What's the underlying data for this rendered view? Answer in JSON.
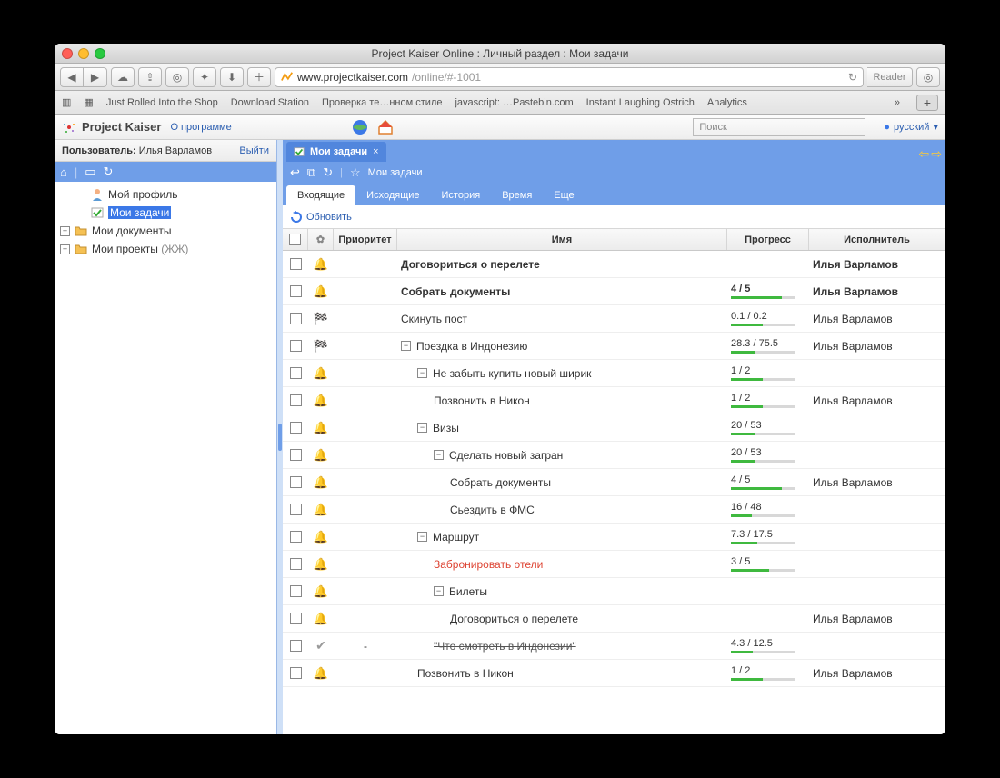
{
  "browser": {
    "title": "Project Kaiser Online : Личный раздел : Мои задачи",
    "url_host": "www.projectkaiser.com",
    "url_path": "/online/#-1001",
    "reader": "Reader",
    "bookmarks": [
      "Just Rolled Into the Shop",
      "Download Station",
      "Проверка те…нном стиле",
      "javascript: …Pastebin.com",
      "Instant Laughing Ostrich",
      "Analytics"
    ]
  },
  "app": {
    "name": "Project Kaiser",
    "about": "О программе",
    "search_placeholder": "Поиск",
    "lang": "русский"
  },
  "sidebar": {
    "user_label": "Пользователь:",
    "user_name": "Илья Варламов",
    "logout": "Выйти",
    "items": [
      {
        "label": "Мой профиль"
      },
      {
        "label": "Мои задачи"
      },
      {
        "label": "Мои документы"
      },
      {
        "label": "Мои проекты",
        "suffix": "(ЖЖ)"
      }
    ]
  },
  "main": {
    "doctab": "Мои задачи",
    "crumb": "Мои задачи",
    "tabs": [
      "Входящие",
      "Исходящие",
      "История",
      "Время",
      "Еще"
    ],
    "refresh": "Обновить",
    "columns": {
      "priority": "Приоритет",
      "name": "Имя",
      "progress": "Прогресс",
      "assignee": "Исполнитель"
    }
  },
  "rows": [
    {
      "icon": "bell",
      "indent": 0,
      "name": "Договориться о перелете",
      "bold": true,
      "assignee": "Илья Варламов"
    },
    {
      "icon": "bell",
      "indent": 0,
      "name": "Собрать документы",
      "bold": true,
      "progress": "4 / 5",
      "pct": 80,
      "assignee": "Илья Варламов"
    },
    {
      "icon": "flag",
      "indent": 0,
      "name": "Скинуть пост",
      "progress": "0.1 / 0.2",
      "pct": 50,
      "assignee": "Илья Варламов"
    },
    {
      "icon": "flag",
      "indent": 0,
      "toggle": true,
      "name": "Поездка в Индонезию",
      "progress": "28.3 / 75.5",
      "pct": 37,
      "assignee": "Илья Варламов"
    },
    {
      "icon": "bell",
      "indent": 1,
      "toggle": true,
      "name": "Не забыть купить новый ширик",
      "progress": "1 / 2",
      "pct": 50
    },
    {
      "icon": "bell",
      "indent": 2,
      "name": "Позвонить в Никон",
      "progress": "1 / 2",
      "pct": 50,
      "assignee": "Илья Варламов"
    },
    {
      "icon": "bell",
      "indent": 1,
      "toggle": true,
      "name": "Визы",
      "progress": "20 / 53",
      "pct": 38
    },
    {
      "icon": "bell",
      "indent": 2,
      "toggle": true,
      "name": "Сделать новый загран",
      "progress": "20 / 53",
      "pct": 38
    },
    {
      "icon": "bell",
      "indent": 3,
      "name": "Собрать документы",
      "progress": "4 / 5",
      "pct": 80,
      "assignee": "Илья Варламов"
    },
    {
      "icon": "bell",
      "indent": 3,
      "name": "Сьездить в ФМС",
      "progress": "16 / 48",
      "pct": 33
    },
    {
      "icon": "bell",
      "indent": 1,
      "toggle": true,
      "name": "Маршрут",
      "progress": "7.3 / 17.5",
      "pct": 42
    },
    {
      "icon": "bell",
      "indent": 2,
      "name": "Забронировать отели",
      "red": true,
      "progress": "3 / 5",
      "pct": 60
    },
    {
      "icon": "bell",
      "indent": 2,
      "toggle": true,
      "name": "Билеты"
    },
    {
      "icon": "bell",
      "indent": 3,
      "name": "Договориться о перелете",
      "assignee": "Илья Варламов"
    },
    {
      "icon": "tick",
      "priority": "-",
      "indent": 2,
      "name": "\"Что смотреть в Индонезии\"",
      "strike": true,
      "progress": "4.3 / 12.5",
      "pct": 34
    },
    {
      "icon": "bell",
      "indent": 1,
      "name": "Позвонить в Никон",
      "progress": "1 / 2",
      "pct": 50,
      "assignee": "Илья Варламов"
    }
  ]
}
